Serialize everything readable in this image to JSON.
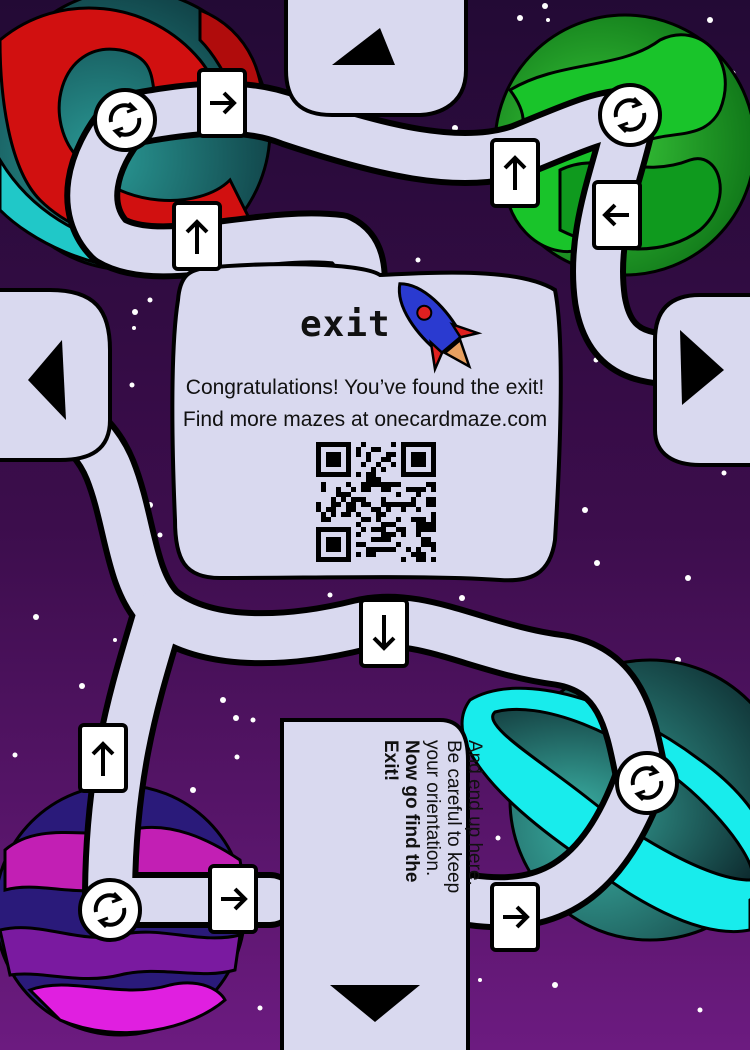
{
  "exit_panel": {
    "title": "exit",
    "message_line1": "Congratulations! You’ve found the exit!",
    "message_line2": "Find more mazes at onecardmaze.com"
  },
  "end_panel": {
    "line1": "And end up here.",
    "line2": "Be careful to keep",
    "line3": "your orientation.",
    "line4": "Now go find the",
    "line5": "Exit!"
  },
  "arrow_cards": [
    {
      "id": "top-left-right",
      "direction": "right"
    },
    {
      "id": "left-up",
      "direction": "up"
    },
    {
      "id": "top-right-up",
      "direction": "up"
    },
    {
      "id": "top-right-left",
      "direction": "left"
    },
    {
      "id": "center-down",
      "direction": "down"
    },
    {
      "id": "bottom-left-up",
      "direction": "up"
    },
    {
      "id": "bottom-left-right",
      "direction": "right"
    },
    {
      "id": "bottom-right-right",
      "direction": "right"
    }
  ],
  "colors": {
    "path": "#d9d9ef",
    "outline": "#000000",
    "space_top": "#2a0a3a",
    "space_bottom": "#6a1a7a"
  },
  "icons": [
    "rotate-icon",
    "rocket-icon",
    "qr-code",
    "edge-exit-triangle"
  ]
}
